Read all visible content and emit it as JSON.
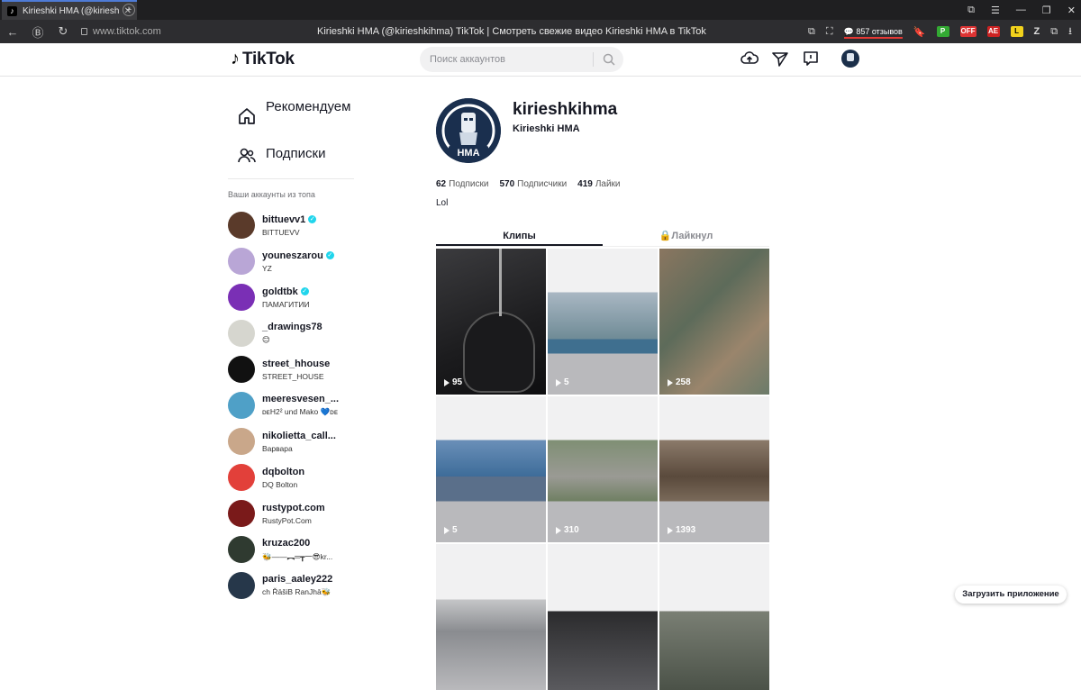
{
  "browser": {
    "tab_title": "Kirieshki HMA (@kirieshkihma) TikTok",
    "url": "www.tiktok.com",
    "page_title": "Kirieshki HMA (@kirieshkihma) TikTok | Смотреть свежие видео Kirieshki HMA в TikTok",
    "reviews_badge": "857 отзывов",
    "ext_off_label": "OFF",
    "ext_ae_label": "AE",
    "ext_z_label": "Z"
  },
  "header": {
    "logo_text": "TikTok",
    "search_placeholder": "Поиск аккаунтов"
  },
  "sidebar": {
    "nav": [
      {
        "label": "Рекомендуем"
      },
      {
        "label": "Подписки"
      }
    ],
    "heading": "Ваши аккаунты из топа",
    "accounts": [
      {
        "name": "bittuevv1",
        "sub": "BITTUEVV",
        "verified": true,
        "color": "#5a3a2a"
      },
      {
        "name": "youneszarou",
        "sub": "YZ",
        "verified": true,
        "color": "#b9a6d6"
      },
      {
        "name": "goldtbk",
        "sub": "ПАМАГИТИИ",
        "verified": true,
        "color": "#7a2fb5"
      },
      {
        "name": "_drawings78",
        "sub": "😊",
        "verified": false,
        "color": "#d6d6cf"
      },
      {
        "name": "street_hhouse",
        "sub": "STREET_HOUSE",
        "verified": false,
        "color": "#111111"
      },
      {
        "name": "meeresvesen_...",
        "sub": "ᴅᴇH2² und Mako 💙ᴅᴇ",
        "verified": false,
        "color": "#4fa0c7"
      },
      {
        "name": "nikolietta_call...",
        "sub": "Варвара",
        "verified": false,
        "color": "#c9a78a"
      },
      {
        "name": "dqbolton",
        "sub": "DQ Bolton",
        "verified": false,
        "color": "#e2403a"
      },
      {
        "name": "rustypot.com",
        "sub": "RustyPot.Com",
        "verified": false,
        "color": "#7a1a1a"
      },
      {
        "name": "kruzac200",
        "sub": "🐝——︻═┳一😎kr...",
        "verified": false,
        "color": "#2f3a30"
      },
      {
        "name": "paris_aaley222",
        "sub": "ch ŘāšiB RanJhā🐝",
        "verified": false,
        "color": "#26374a"
      }
    ]
  },
  "profile": {
    "handle": "kirieshkihma",
    "name": "Kirieshki HMA",
    "avatar_text": "HMA",
    "following_count": "62",
    "following_label": "Подписки",
    "followers_count": "570",
    "followers_label": "Подписчики",
    "likes_count": "419",
    "likes_label": "Лайки",
    "bio": "Lol",
    "tab_videos": "Клипы",
    "tab_liked": "Лайкнул"
  },
  "videos": [
    {
      "views": "95",
      "theme": "mouse"
    },
    {
      "views": "5",
      "theme": "dojo"
    },
    {
      "views": "258",
      "theme": "rock"
    },
    {
      "views": "5",
      "theme": "pool"
    },
    {
      "views": "310",
      "theme": "path"
    },
    {
      "views": "1393",
      "theme": "house"
    },
    {
      "views": "",
      "theme": "fence"
    },
    {
      "views": "",
      "theme": "room"
    },
    {
      "views": "",
      "theme": "cave"
    }
  ],
  "footer": {
    "get_app": "Загрузить приложение"
  }
}
